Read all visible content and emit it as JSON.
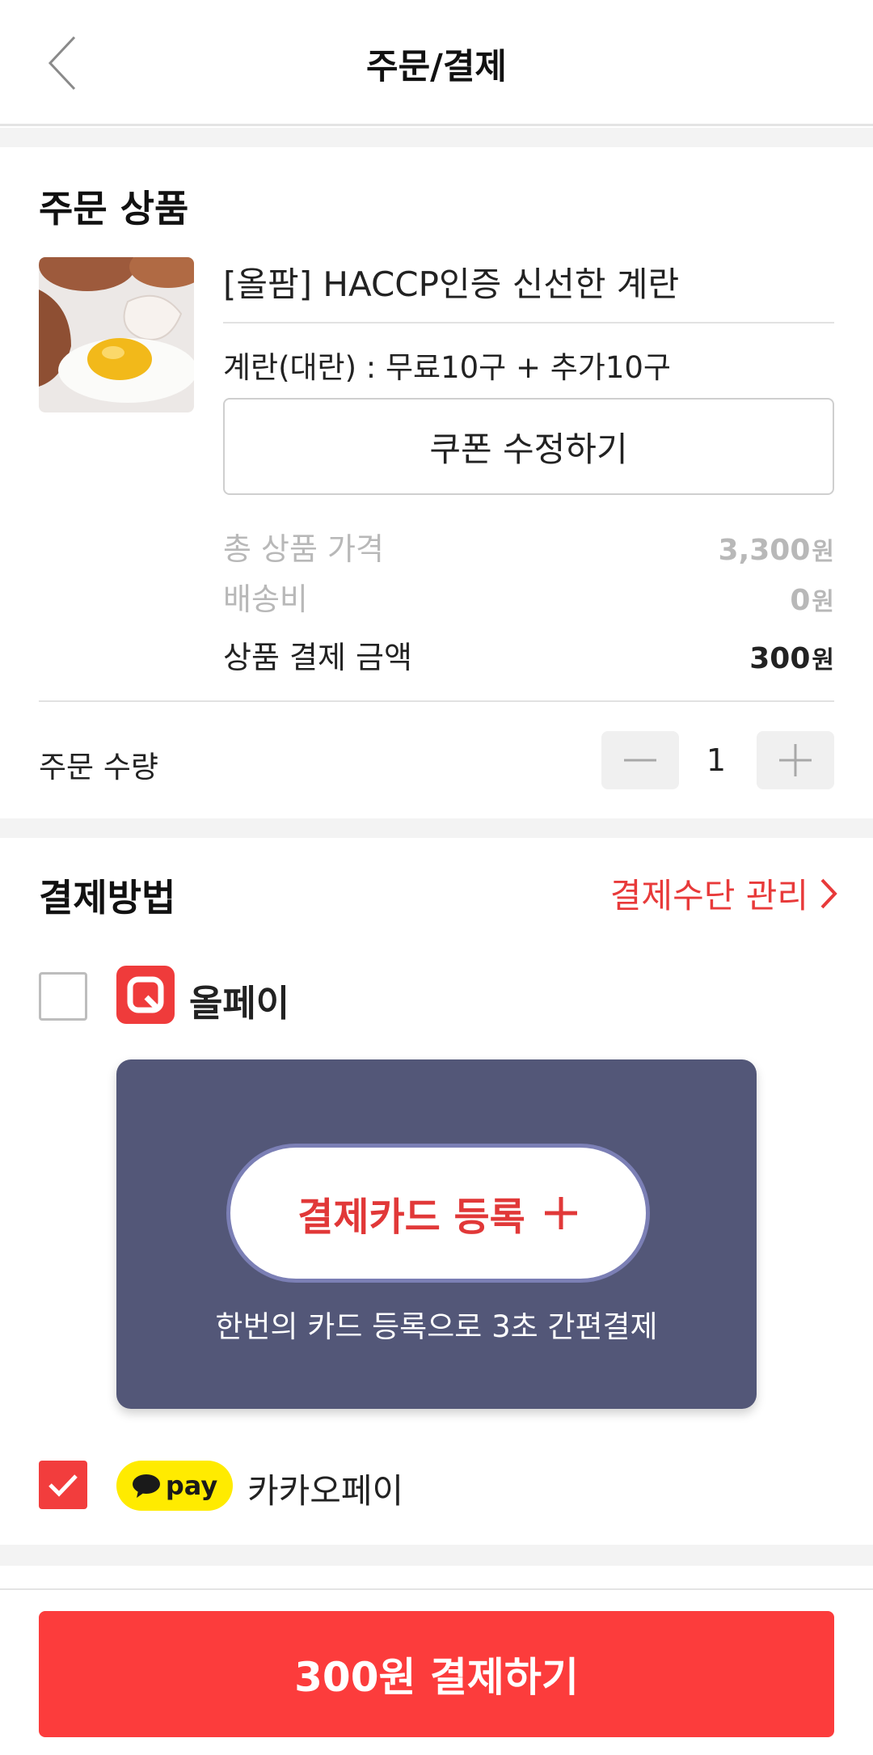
{
  "header": {
    "title": "주문/결제"
  },
  "order": {
    "section_title": "주문 상품",
    "product_name": "[올팜] HACCP인증 신선한 계란",
    "option": "계란(대란) : 무료10구 + 추가10구",
    "coupon_button": "쿠폰 수정하기",
    "prices": [
      {
        "label": "총 상품 가격",
        "amount": "3,300",
        "unit": "원"
      },
      {
        "label": "배송비",
        "amount": "0",
        "unit": "원"
      },
      {
        "label": "상품 결제 금액",
        "amount": "300",
        "unit": "원"
      }
    ],
    "quantity": {
      "label": "주문 수량",
      "value": "1"
    }
  },
  "payment": {
    "section_title": "결제방법",
    "manage_link": "결제수단 관리",
    "allpay": {
      "label": "올페이",
      "checked": false
    },
    "register_card": {
      "label": "결제카드 등록",
      "caption": "한번의 카드 등록으로 3초 간편결제"
    },
    "kakaopay": {
      "badge": "pay",
      "label": "카카오페이",
      "checked": true
    }
  },
  "footer": {
    "pay_button": "300원 결제하기"
  },
  "colors": {
    "accent": "#f23d3d",
    "panel": "#535778",
    "kakao": "#ffeb00"
  }
}
